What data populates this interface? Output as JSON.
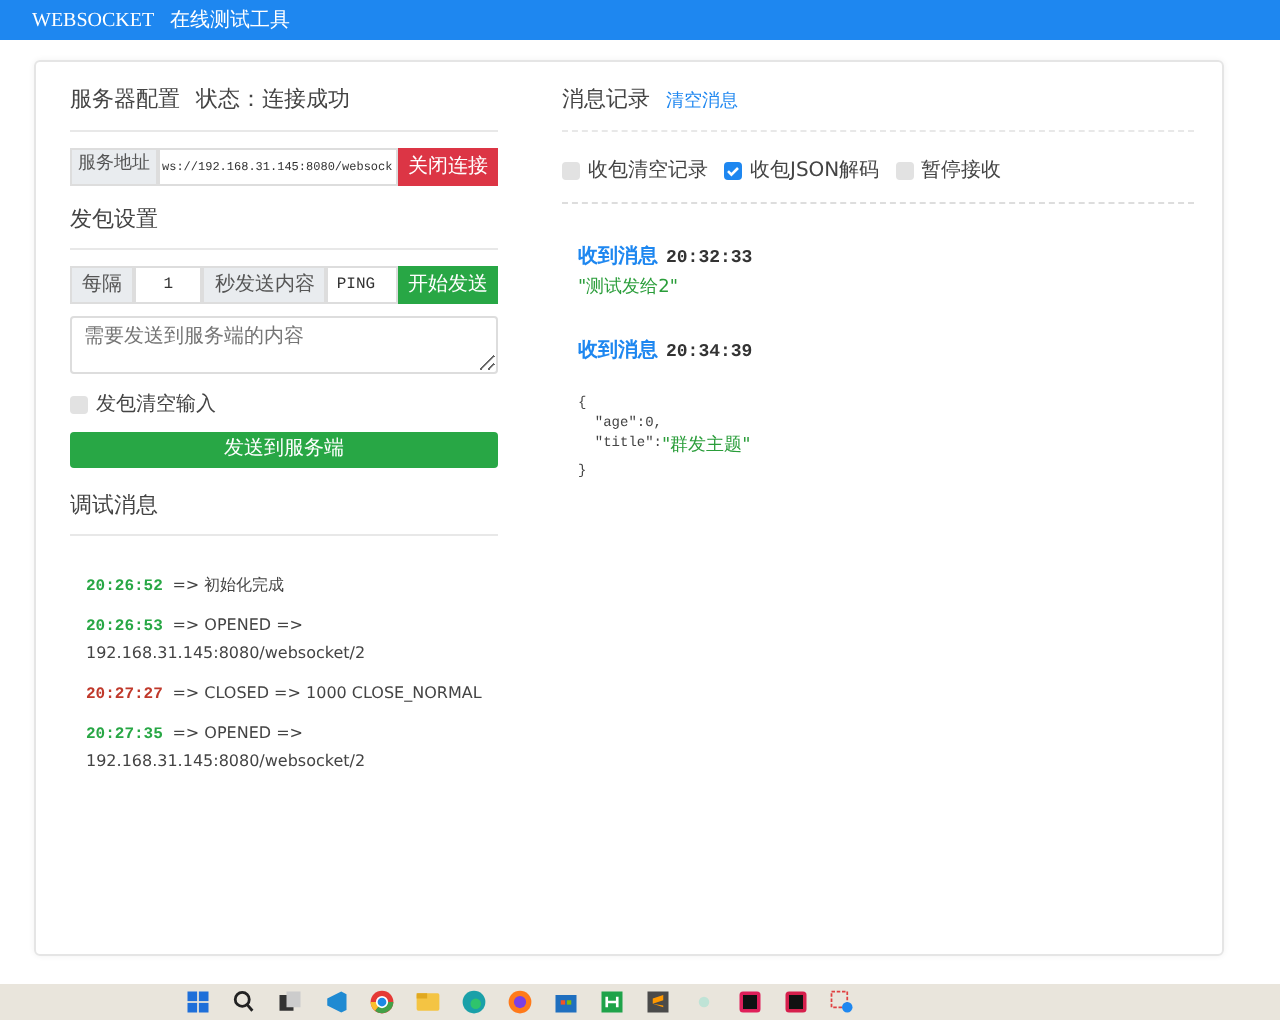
{
  "navbar": {
    "brand": "WEBSOCKET",
    "subtitle": "在线测试工具"
  },
  "server": {
    "title": "服务器配置",
    "status": "状态：连接成功",
    "address_label": "服务地址",
    "address": "ws://192.168.31.145:8080/websock",
    "close_button": "关闭连接"
  },
  "send_settings": {
    "title": "发包设置",
    "every_label": "每隔",
    "interval": "1",
    "content_label": "秒发送内容",
    "content": "PING",
    "start_button": "开始发送",
    "placeholder": "需要发送到服务端的内容",
    "clear_input": {
      "label": "发包清空输入",
      "checked": false
    },
    "send_button": "发送到服务端"
  },
  "debug": {
    "title": "调试消息",
    "entries": [
      {
        "time": "20:26:52",
        "text": "=> 初始化完成",
        "color": "#28a745"
      },
      {
        "time": "20:26:53",
        "text": "=> OPENED => 192.168.31.145:8080/websocket/2",
        "color": "#28a745"
      },
      {
        "time": "20:27:27",
        "text": "=> CLOSED => 1000 CLOSE_NORMAL",
        "color": "#c0392b"
      },
      {
        "time": "20:27:35",
        "text": "=> OPENED => 192.168.31.145:8080/websocket/2",
        "color": "#28a745"
      }
    ]
  },
  "messages": {
    "title": "消息记录",
    "clear_link": "清空消息",
    "options": [
      {
        "label": "收包清空记录",
        "checked": false
      },
      {
        "label": "收包JSON解码",
        "checked": true
      },
      {
        "label": "暂停接收",
        "checked": false
      }
    ],
    "items": [
      {
        "title": "收到消息",
        "time": "20:32:33",
        "lines": [
          {
            "string": "\"测试发给2\""
          }
        ]
      },
      {
        "title": "收到消息",
        "time": "20:34:39",
        "lines": [
          {
            "code": "{"
          },
          {
            "code": "  \"age\":0,"
          },
          {
            "code": "  \"title\":",
            "string": "\"群发主题\""
          },
          {
            "code": "}"
          }
        ]
      }
    ]
  }
}
